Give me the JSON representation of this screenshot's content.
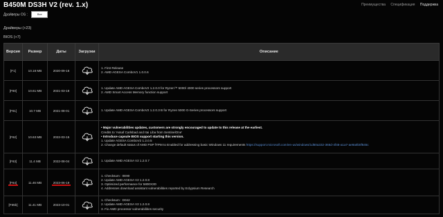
{
  "title": "B450M DS3H V2  (rev. 1.x)",
  "nav": [
    "Преимущества",
    "Спецификация",
    "Поддержка"
  ],
  "os_label": "Драйверы OS :",
  "os_value": "Bce",
  "drivers_label": "Драйверы (+23)",
  "bios_label": "BIOS (+7)",
  "columns": [
    "Версия",
    "Размер",
    "Даты",
    "Загрузки",
    "Описание"
  ],
  "rows": [
    {
      "version": "[F1]",
      "size": "10.18 MB",
      "date": "2020-09-16",
      "desc": [
        {
          "text": "1. First Release"
        },
        {
          "text": "2. AMD AGESA ComboV1 1.0.0.6"
        }
      ]
    },
    {
      "version": "[F60]",
      "size": "10.61 MB",
      "date": "2021-03-18",
      "desc": [
        {
          "text": "1. Update AMD AGESA ComboV2 1.2.0.0 for Ryzen™ 5000/ 4000 series processors support"
        },
        {
          "text": "2. AMD Smart Access Memory function support"
        }
      ]
    },
    {
      "version": "[F61]",
      "size": "10.7 MB",
      "date": "2021-08-01",
      "desc": [
        {
          "text": "1. Update AMD AGESA ComboV2 1.2.0.3 B for Ryzen 5000 G-Series processors support"
        }
      ]
    },
    {
      "version": "[F62]",
      "size": "10.63 MB",
      "date": "2022-03-15",
      "desc": [
        {
          "text": "• Major vulnerabilities updates, customers are strongly encouraged to update to this release at the earliest.",
          "bold": true
        },
        {
          "text": "Credits to 'Assaf Carlsbad and Itai Liba from SentinelOne'"
        },
        {
          "text": "• Introduce capsule BIOS support starting this version.",
          "bold": true
        },
        {
          "text": "1. Update AGESA ComboV2 1.2.0.5"
        },
        {
          "text": "2. Change default status of AMD PSP fTPM to Enabled for addressing basic Windows 11 requirements",
          "link": "https://support.microsoft.com/en-us/windows/1d60a332-366d-4f46-a1a7-ae9a0b0f845c"
        }
      ]
    },
    {
      "version": "[F63]",
      "size": "11.4 MB",
      "date": "2022-08-04",
      "desc": [
        {
          "text": "1. Update AMD AGESA V2 1.2.0.7"
        }
      ]
    },
    {
      "version": "[F64]",
      "size": "11.46 MB",
      "date": "2023-06-19",
      "highlight": true,
      "desc": [
        {
          "text": "1. Checksum : 0E90"
        },
        {
          "text": "2. Update AMD AGESA V2 1.2.0.8"
        },
        {
          "text": "3. Optimized performance for 5800X3D"
        },
        {
          "text": "4. Addresses download assistant vulnerabilities reported by Eclypsium Research"
        }
      ]
    },
    {
      "version": "[F65b]",
      "size": "11.41 MB",
      "date": "2023-10-01",
      "desc": [
        {
          "text": "1. Checksum : D042"
        },
        {
          "text": "2. Update AMD AGESA V2 1.2.0.8"
        },
        {
          "text": "3. Fix AMD processor vulnerabilities security"
        }
      ]
    }
  ],
  "colors": {
    "background": "#050505",
    "header_bg": "#2a2a2a",
    "highlight": "#cc1111",
    "link": "#5b8fd6"
  },
  "icons": {
    "download": "cloud-download-icon"
  }
}
